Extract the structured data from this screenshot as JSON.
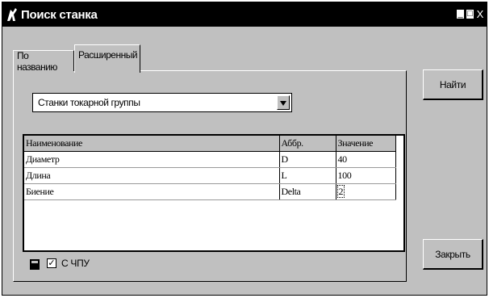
{
  "window": {
    "title": "Поиск станка",
    "icon": "machine-tool-icon",
    "controls": [
      "_",
      "□",
      "X"
    ]
  },
  "tabs": [
    {
      "label": "По названию",
      "active": false
    },
    {
      "label": "Расширенный",
      "active": true
    }
  ],
  "combo": {
    "value": "Станки токарной группы",
    "icon": "chevron-down-icon"
  },
  "grid": {
    "columns": [
      "Наименование",
      "Аббр.",
      "Значение"
    ],
    "rows": [
      [
        "Диаметр",
        "D",
        "40"
      ],
      [
        "Длина",
        "L",
        "100"
      ],
      [
        "Биение",
        "Delta",
        "2"
      ]
    ]
  },
  "cnc": {
    "label": "С ЧПУ",
    "checked": true,
    "checkmark": "✓",
    "icon": "calculator-icon"
  },
  "buttons": {
    "find": "Найти",
    "close": "Закрыть"
  }
}
